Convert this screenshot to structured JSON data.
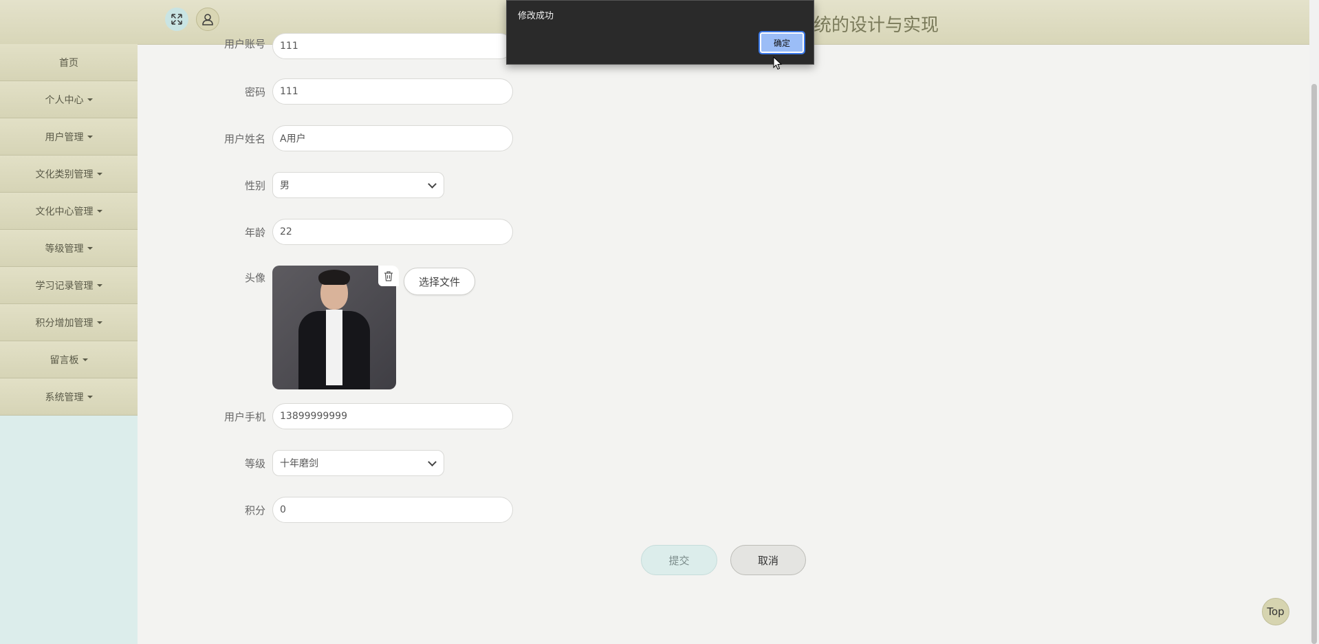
{
  "header": {
    "title": "统的设计与实现",
    "expand_icon": "expand-arrows-icon",
    "user_icon": "user-icon"
  },
  "sidebar": {
    "items": [
      {
        "label": "首页",
        "has_caret": false
      },
      {
        "label": "个人中心",
        "has_caret": true
      },
      {
        "label": "用户管理",
        "has_caret": true
      },
      {
        "label": "文化类别管理",
        "has_caret": true
      },
      {
        "label": "文化中心管理",
        "has_caret": true
      },
      {
        "label": "等级管理",
        "has_caret": true
      },
      {
        "label": "学习记录管理",
        "has_caret": true
      },
      {
        "label": "积分增加管理",
        "has_caret": true
      },
      {
        "label": "留言板",
        "has_caret": true
      },
      {
        "label": "系统管理",
        "has_caret": true
      }
    ]
  },
  "form": {
    "account": {
      "label": "用户账号",
      "value": "111"
    },
    "password": {
      "label": "密码",
      "value": "111"
    },
    "name": {
      "label": "用户姓名",
      "value": "A用户"
    },
    "gender": {
      "label": "性别",
      "value": "男"
    },
    "age": {
      "label": "年龄",
      "value": "22"
    },
    "avatar": {
      "label": "头像",
      "choose_label": "选择文件",
      "delete_icon": "trash-icon"
    },
    "phone": {
      "label": "用户手机",
      "value": "13899999999"
    },
    "level": {
      "label": "等级",
      "value": "十年磨剑"
    },
    "points": {
      "label": "积分",
      "value": "0"
    },
    "submit_label": "提交",
    "cancel_label": "取消"
  },
  "top_button": "Top",
  "dialog": {
    "message": "修改成功",
    "ok_label": "确定"
  },
  "colors": {
    "header_bg": "#dcdabd",
    "sidebar_bg": "#dcedeb",
    "dialog_bg": "#2a2a2a",
    "ok_button": "#9bbdf7"
  }
}
